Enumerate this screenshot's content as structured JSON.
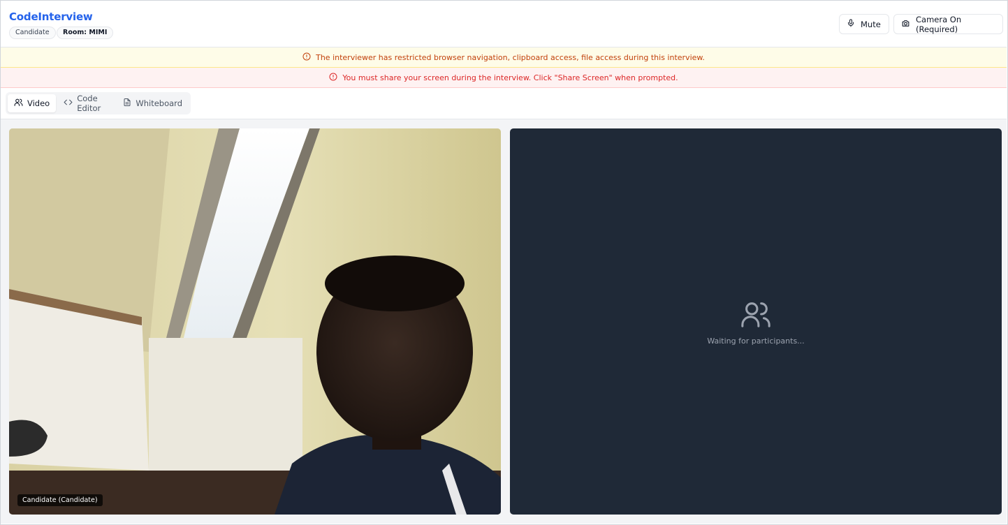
{
  "header": {
    "brand": "CodeInterview",
    "role_badge": "Candidate",
    "room_badge": "Room: MIMI",
    "mute_label": "Mute",
    "camera_label": "Camera On (Required)"
  },
  "banners": {
    "restriction": "The interviewer has restricted browser navigation, clipboard access, file access during this interview.",
    "screen_share": "You must share your screen during the interview. Click \"Share Screen\" when prompted."
  },
  "tabs": [
    {
      "label": "Video",
      "icon": "users-icon",
      "active": true
    },
    {
      "label": "Code Editor",
      "icon": "code-icon",
      "active": false
    },
    {
      "label": "Whiteboard",
      "icon": "document-icon",
      "active": false
    }
  ],
  "video": {
    "local_label": "Candidate (Candidate)",
    "remote_status": "Waiting for participants..."
  },
  "colors": {
    "brand": "#2563eb",
    "warning_text": "#c2410c",
    "warning_bg": "#fefce8",
    "error_text": "#dc2626",
    "error_bg": "#fef2f2",
    "remote_tile_bg": "#1f2937"
  }
}
